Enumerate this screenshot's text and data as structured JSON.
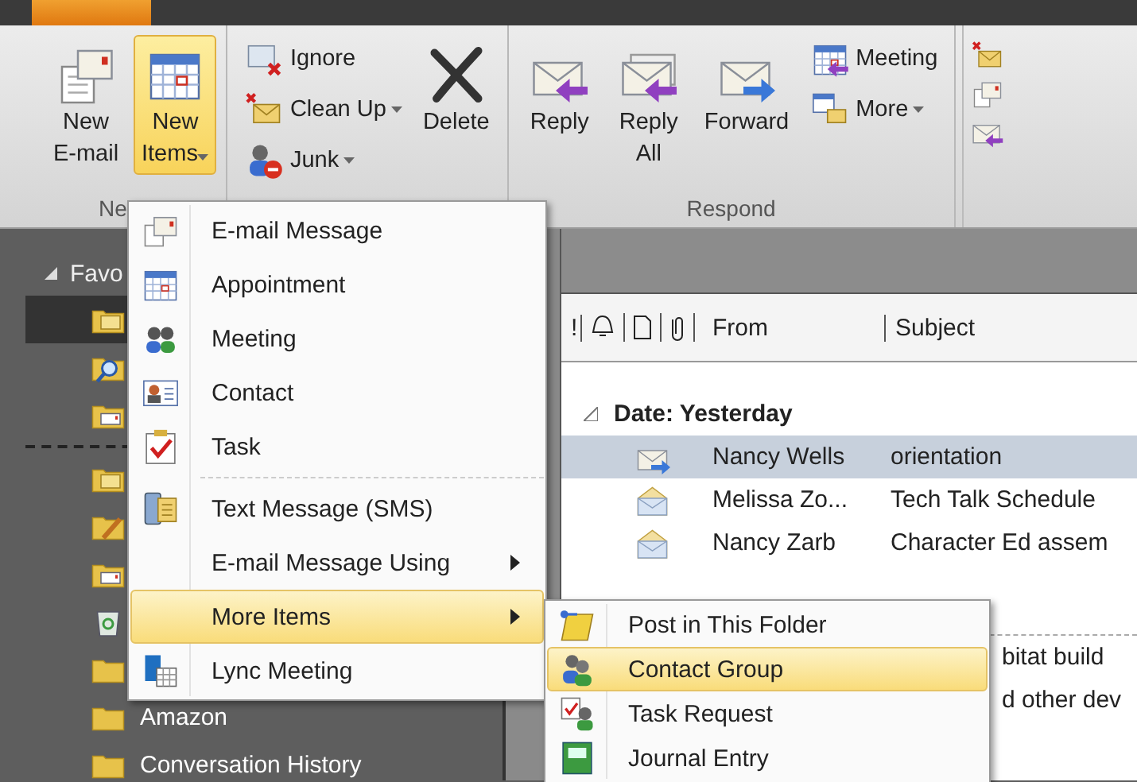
{
  "ribbon": {
    "groups": [
      {
        "label": "Ne",
        "buttons": [
          {
            "label": "New\nE-mail",
            "kind": "large",
            "selected": false,
            "dropdown": false
          },
          {
            "label": "New\nItems",
            "kind": "large",
            "selected": true,
            "dropdown": true
          }
        ]
      },
      {
        "buttons": [
          {
            "label": "Ignore",
            "kind": "small",
            "selected": false,
            "dropdown": false
          },
          {
            "label": "Clean Up",
            "kind": "small",
            "selected": false,
            "dropdown": true
          },
          {
            "label": "Junk",
            "kind": "small",
            "selected": false,
            "dropdown": true
          },
          {
            "label": "Delete",
            "kind": "large",
            "selected": false,
            "dropdown": false
          }
        ]
      },
      {
        "label": "Respond",
        "buttons": [
          {
            "label": "Reply",
            "kind": "large",
            "selected": false,
            "dropdown": false
          },
          {
            "label": "Reply\nAll",
            "kind": "large",
            "selected": false,
            "dropdown": false
          },
          {
            "label": "Forward",
            "kind": "large",
            "selected": false,
            "dropdown": false
          },
          {
            "label": "Meeting",
            "kind": "small",
            "selected": false,
            "dropdown": false
          },
          {
            "label": "More",
            "kind": "small",
            "selected": false,
            "dropdown": true
          }
        ]
      }
    ]
  },
  "nav": {
    "header": "Favo",
    "folders": [
      {
        "selected": true
      },
      {
        "selected": false
      },
      {
        "selected": false
      },
      {
        "selected": false,
        "separator_before": true
      },
      {
        "selected": false
      },
      {
        "selected": false
      },
      {
        "selected": false
      },
      {
        "selected": false
      },
      {
        "name": "Amazon",
        "selected": false
      },
      {
        "name": "Conversation History",
        "selected": false
      }
    ]
  },
  "message_list": {
    "columns": [
      "!",
      "From",
      "Subject"
    ],
    "groups": [
      {
        "label": "Date: Yesterday",
        "rows": [
          {
            "from": "Nancy Wells",
            "subject": "orientation",
            "selected": true
          },
          {
            "from": "Melissa Zo...",
            "subject": "Tech Talk Schedule",
            "selected": false
          },
          {
            "from": "Nancy Zarb",
            "subject": "Character Ed assem",
            "selected": false
          }
        ]
      },
      {
        "rows": [
          {
            "subject": "bitat build",
            "selected": false
          },
          {
            "subject": "d other dev",
            "selected": false
          }
        ]
      }
    ]
  },
  "menu": {
    "items": [
      {
        "kind": "item",
        "label": "E-mail Message",
        "selected": false,
        "submenu": false
      },
      {
        "kind": "item",
        "label": "Appointment",
        "selected": false,
        "submenu": false
      },
      {
        "kind": "item",
        "label": "Meeting",
        "selected": false,
        "submenu": false
      },
      {
        "kind": "item",
        "label": "Contact",
        "selected": false,
        "submenu": false
      },
      {
        "kind": "item",
        "label": "Task",
        "selected": false,
        "submenu": false
      },
      {
        "kind": "separator"
      },
      {
        "kind": "item",
        "label": "Text Message (SMS)",
        "selected": false,
        "submenu": false
      },
      {
        "kind": "item",
        "label": "E-mail Message Using",
        "selected": false,
        "submenu": true
      },
      {
        "kind": "item",
        "label": "More Items",
        "selected": true,
        "submenu": true
      },
      {
        "kind": "item",
        "label": "Lync Meeting",
        "selected": false,
        "submenu": false
      }
    ]
  },
  "submenu": {
    "items": [
      {
        "kind": "item",
        "label": "Post in This Folder",
        "selected": false,
        "submenu": false
      },
      {
        "kind": "item",
        "label": "Contact Group",
        "selected": true,
        "submenu": false
      },
      {
        "kind": "item",
        "label": "Task Request",
        "selected": false,
        "submenu": false
      },
      {
        "kind": "item",
        "label": "Journal Entry",
        "selected": false,
        "submenu": false
      }
    ]
  }
}
